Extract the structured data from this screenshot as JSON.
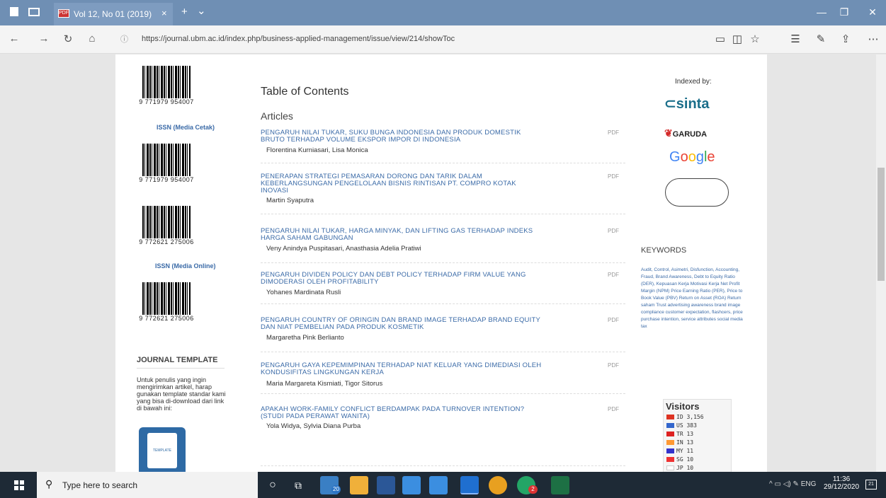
{
  "browser": {
    "tab_title": "Vol 12, No 01 (2019)",
    "tab_icon_text": "PDF",
    "tab_close": "×",
    "new_tab": "+",
    "tab_menu": "⌄",
    "url": "https://journal.ubm.ac.id/index.php/business-applied-management/issue/view/214/showToc",
    "window_controls": [
      "—",
      "❐",
      "✕"
    ]
  },
  "left_sidebar": {
    "barcodes": [
      {
        "number": "9 771979 954007"
      },
      {
        "number": "9 771979 954007"
      },
      {
        "number": "9 772621 275006"
      },
      {
        "number": "9 772621 275006"
      }
    ],
    "issn_print_label": "ISSN (Media Cetak)",
    "issn_online_label": "ISSN (Media Online)",
    "template_heading": "JOURNAL TEMPLATE",
    "template_description": "Untuk penulis yang ingin mengirimkan artikel, harap gunakan template standar kami yang bisa di-download dari link di bawah ini:",
    "template_icon_label": "TEMPLATE"
  },
  "main": {
    "toc_title": "Table of Contents",
    "section_heading": "Articles",
    "pdf_label": "PDF",
    "articles": [
      {
        "title": "PENGARUH NILAI TUKAR, SUKU BUNGA INDONESIA DAN PRODUK DOMESTIK BRUTO TERHADAP VOLUME EKSPOR IMPOR DI INDONESIA",
        "authors": "Florentina Kurniasari, Lisa Monica"
      },
      {
        "title": "PENERAPAN STRATEGI PEMASARAN DORONG DAN TARIK DALAM KEBERLANGSUNGAN PENGELOLAAN BISNIS RINTISAN PT. COMPRO KOTAK INOVASI",
        "authors": "Martin Syaputra"
      },
      {
        "title": "PENGARUH NILAI TUKAR, HARGA MINYAK, DAN LIFTING GAS TERHADAP INDEKS HARGA SAHAM GABUNGAN",
        "authors": "Veny Anindya Puspitasari, Anasthasia Adelia Pratiwi"
      },
      {
        "title": "PENGARUH DIVIDEN POLICY DAN DEBT POLICY TERHADAP FIRM VALUE YANG DIMODERASI OLEH PROFITABILITY",
        "authors": "Yohanes Mardinata Rusli"
      },
      {
        "title": "PENGARUH COUNTRY OF ORINGIN DAN BRAND IMAGE TERHADAP BRAND EQUITY DAN NIAT PEMBELIAN PADA PRODUK KOSMETIK",
        "authors": "Margaretha Pink Berlianto"
      },
      {
        "title": "PENGARUH GAYA KEPEMIMPINAN TERHADAP NIAT KELUAR YANG DIMEDIASI OLEH KONDUSIFITAS LINGKUNGAN KERJA",
        "authors": "Maria Margareta Kismiati, Tigor Sitorus"
      },
      {
        "title": "APAKAH WORK-FAMILY CONFLICT BERDAMPAK PADA TURNOVER INTENTION? (STUDI PADA PERAWAT WANITA)",
        "authors": "Yola Widya, Sylvia Diana Purba"
      }
    ]
  },
  "right_sidebar": {
    "indexed_by": "Indexed by:",
    "logos": {
      "sinta": "sinta",
      "garuda": "GARUDA",
      "google": [
        "G",
        "o",
        "o",
        "g",
        "l",
        "e"
      ]
    },
    "keywords_heading": "KEYWORDS",
    "keywords_text": "Audit, Control, Asimetri, Disfunction, Accounting, Fraud, Brand Awareness, Debt to Equity Ratio (DER), Kepuasan Kerja Motivasi Kerja Net Profit Margin (NPM) Price Earning Ratio (PER), Price to Book Value (PBV) Return on Asset (ROA) Return saham Trust advertising awareness brand image compliance customer expectation, flashcers, price purchase intention, service attributes social media tax",
    "visitors": {
      "title": "Visitors",
      "rows": [
        {
          "code": "ID",
          "count": "3,156",
          "flag": "#d32"
        },
        {
          "code": "US",
          "count": "383",
          "flag": "#36c"
        },
        {
          "code": "TR",
          "count": "13",
          "flag": "#d22"
        },
        {
          "code": "IN",
          "count": "13",
          "flag": "#f93"
        },
        {
          "code": "MY",
          "count": "11",
          "flag": "#33c"
        },
        {
          "code": "SG",
          "count": "10",
          "flag": "#e33"
        },
        {
          "code": "JP",
          "count": "10",
          "flag": "#e33"
        }
      ]
    }
  },
  "taskbar": {
    "search_placeholder": "Type here to search",
    "mail_badge": "20",
    "chrome_badge": "2",
    "language": "ENG",
    "time": "11:36",
    "date": "29/12/2020",
    "notification_count": "21"
  }
}
